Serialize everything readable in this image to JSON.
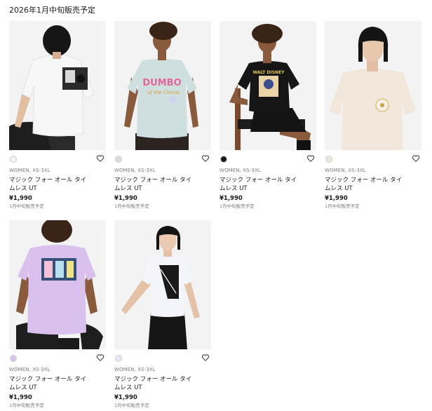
{
  "section": {
    "title": "2026年1月中旬販売予定"
  },
  "products": [
    {
      "swatch": "#f2f2f2",
      "gender": "WOMEN, XS-3XL",
      "name": "マジック フォー オール タイムレス UT",
      "price": "¥1,990",
      "note": "1月中旬販売予定"
    },
    {
      "swatch": "#d9dcdc",
      "gender": "WOMEN, XS-3XL",
      "name": "マジック フォー オール タイムレス UT",
      "price": "¥1,990",
      "note": "1月中旬販売予定"
    },
    {
      "swatch": "#1a1a1a",
      "gender": "WOMEN, XS-3XL",
      "name": "マジック フォー オール タイムレス UT",
      "price": "¥1,990",
      "note": "1月中旬販売予定"
    },
    {
      "swatch": "#efe6da",
      "gender": "WOMEN, XS-3XL",
      "name": "マジック フォー オール タイムレス UT",
      "price": "¥1,990",
      "note": "1月中旬販売予定"
    },
    {
      "swatch": "#dcc4ef",
      "gender": "WOMEN, XS-3XL",
      "name": "マジック フォー オール タイムレス UT",
      "price": "¥1,990",
      "note": "1月中旬販売予定"
    },
    {
      "swatch": "#e6e6f4",
      "gender": "WOMEN, XS-3XL",
      "name": "マジック フォー オール タイムレス UT",
      "price": "¥1,990",
      "note": "1月中旬販売予定"
    }
  ],
  "print_text": {
    "dumbo_line1": "DUMBO",
    "dumbo_line2": "of the Circus",
    "walt_disney": "WALT DISNEY"
  }
}
